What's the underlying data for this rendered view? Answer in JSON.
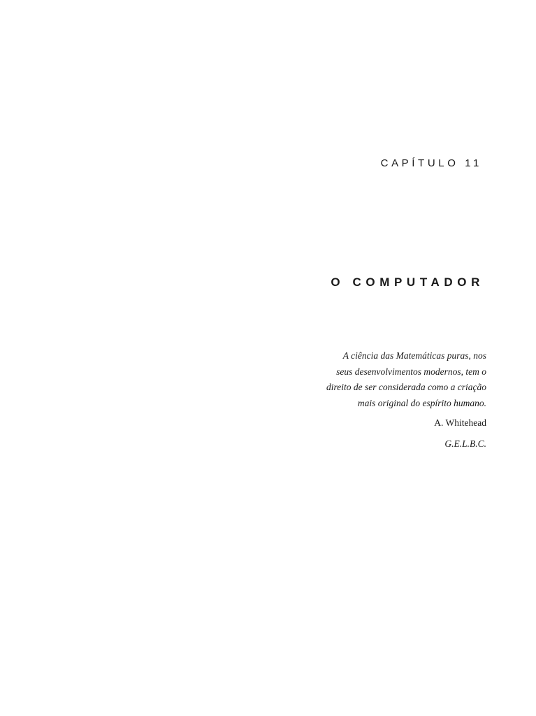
{
  "chapter": {
    "label": "CAPÍTULO 11",
    "title": "O COMPUTADOR"
  },
  "epigraph": {
    "lines": [
      "A ciência das Matemáticas puras, nos",
      "seus desenvolvimentos modernos, tem o",
      "direito de ser considerada como a criação",
      "mais original do espírito humano."
    ],
    "author": "A. Whitehead",
    "translator_note": "G.E.L.B.C."
  }
}
